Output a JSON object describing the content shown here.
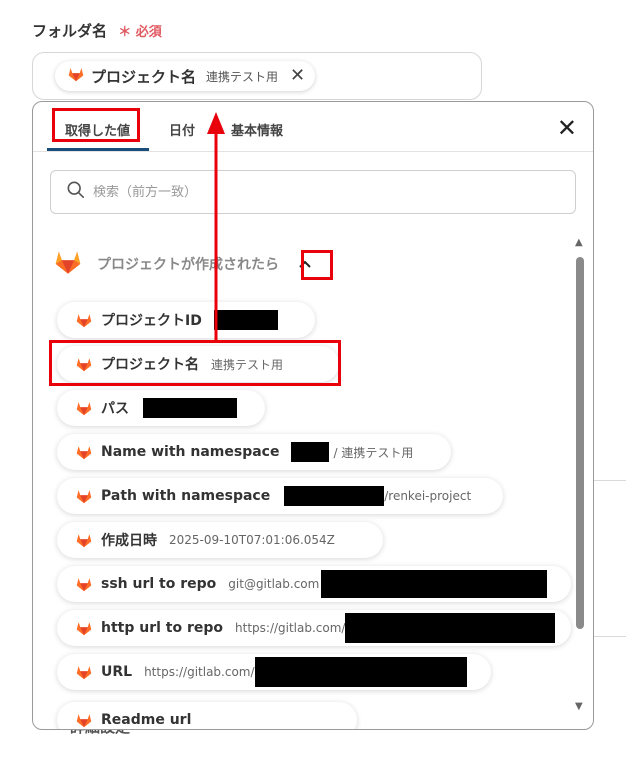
{
  "field": {
    "label": "フォルダ名",
    "required_mark": "＊",
    "required_text": "必須",
    "chip_name": "プロジェクト名",
    "chip_sub": "連携テスト用",
    "chip_remove": "✕"
  },
  "tabs": [
    "取得した値",
    "日付",
    "基本情報"
  ],
  "close_label": "✕",
  "search": {
    "placeholder": "検索（前方一致）"
  },
  "group": {
    "title": "プロジェクトが作成されたら",
    "toggle": "⌃"
  },
  "items": [
    {
      "name": "プロジェクトID",
      "value": ""
    },
    {
      "name": "プロジェクト名",
      "value": "連携テスト用"
    },
    {
      "name": "パス",
      "value": ""
    },
    {
      "name": "Name with namespace",
      "value": "/ 連携テスト用",
      "value_prefix": ""
    },
    {
      "name": "Path with namespace",
      "value": "/renkei-project"
    },
    {
      "name": "作成日時",
      "value": "2025-09-10T07:01:06.054Z"
    },
    {
      "name": "ssh url to repo",
      "value": "git@gitlab.com"
    },
    {
      "name": "http url to repo",
      "value": "https://gitlab.com/"
    },
    {
      "name": "URL",
      "value": "https://gitlab.com/"
    },
    {
      "name": "Readme url",
      "value": ""
    }
  ],
  "background_text": "詳細設定",
  "colors": {
    "accent": "#e8000b",
    "tab_bar": "#1a4e7a",
    "required": "#e05a62",
    "gitlab_orange": "#fc6d26"
  }
}
